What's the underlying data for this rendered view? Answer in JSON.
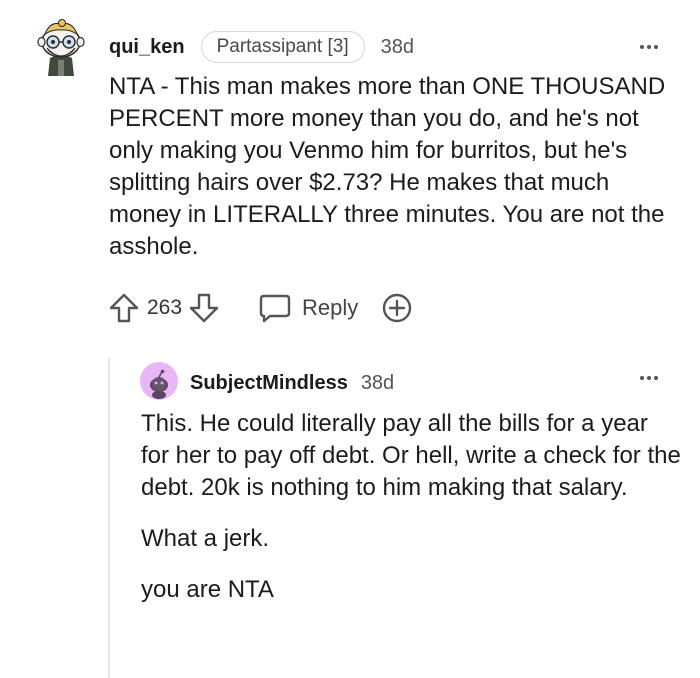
{
  "comment": {
    "username": "qui_ken",
    "flair": "Partassipant [3]",
    "age": "38d",
    "body": "NTA - This man makes more than ONE THOUSAND PERCENT more money than you do, and he's not only making you Venmo him for burritos, but he's splitting hairs over $2.73? He makes that much money in LITERALLY three minutes. You are not the asshole.",
    "vote_count": "263",
    "reply_label": "Reply",
    "avatar_icon": "snoo-avatar-icon",
    "more_icon": "more-options-icon"
  },
  "reply": {
    "username": "SubjectMindless",
    "age": "38d",
    "paragraphs": [
      "This. He could literally pay all the bills for a year for her to pay off debt. Or hell, write a check for the debt. 20k is nothing to him making that salary.",
      "What a jerk.",
      "you are NTA"
    ],
    "avatar_icon": "default-snoo-avatar-icon",
    "more_icon": "more-options-icon"
  },
  "colors": {
    "text": "#1c1c1c",
    "meta": "#555555",
    "flair_border": "#d6d6d6",
    "thread_line": "#e8e8e8",
    "reply_avatar_bg": "#e9b6f5"
  }
}
